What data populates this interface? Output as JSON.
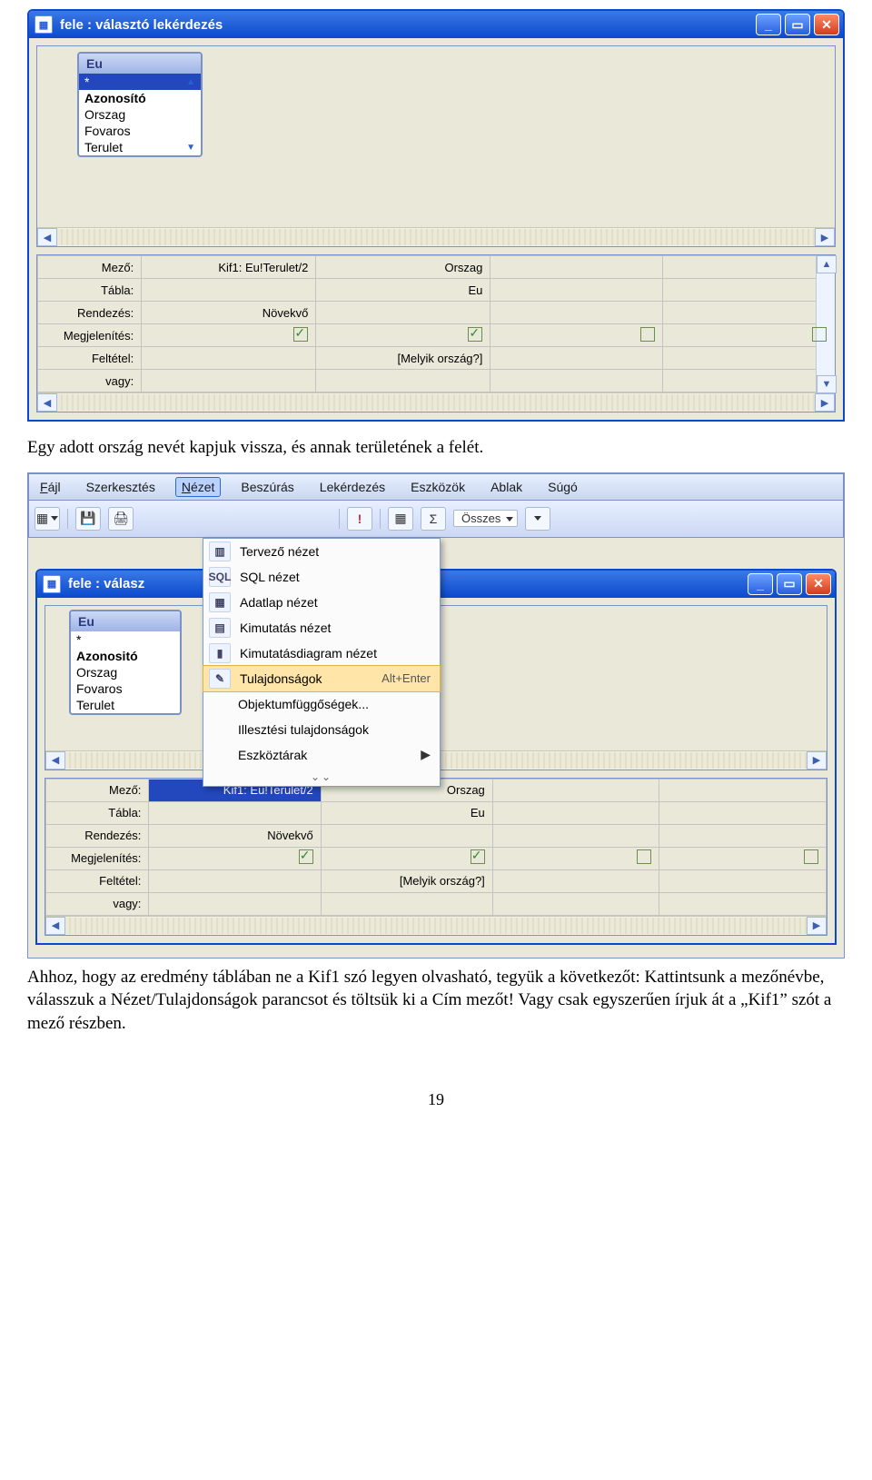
{
  "shot1": {
    "title": "fele : választó lekérdezés",
    "eu_panel_title": "Eu",
    "eu_fields": {
      "star": "*",
      "f1": "Azonosító",
      "f2": "Orszag",
      "f3": "Fovaros",
      "f4": "Terulet"
    },
    "grid_labels": {
      "mezo": "Mező:",
      "tabla": "Tábla:",
      "rendezes": "Rendezés:",
      "megj": "Megjelenítés:",
      "feltetel": "Feltétel:",
      "vagy": "vagy:"
    },
    "grid": {
      "c1": {
        "mezo": "Kif1: Eu!Terulet/2",
        "rendezes": "Növekvő"
      },
      "c2": {
        "mezo": "Orszag",
        "tabla": "Eu",
        "feltetel": "[Melyik ország?]"
      }
    }
  },
  "para1": "Egy adott ország nevét kapjuk vissza, és annak területének a felét.",
  "shot2": {
    "menubar": {
      "fajl": "Fájl",
      "szerk": "Szerkesztés",
      "nezet": "Nézet",
      "beszur": "Beszúrás",
      "lekerd": "Lekérdezés",
      "eszk": "Eszközök",
      "ablak": "Ablak",
      "sugo": "Súgó"
    },
    "toolbar": {
      "osszes": "Összes",
      "sigma": "Σ",
      "bang": "!"
    },
    "nezet_menu": {
      "tervezo": "Tervező nézet",
      "sql": "SQL nézet",
      "sql_icon": "SQL",
      "adatlap": "Adatlap nézet",
      "kimutatas": "Kimutatás nézet",
      "kimdiag": "Kimutatásdiagram nézet",
      "tulajd": "Tulajdonságok",
      "tulajd_shortcut": "Alt+Enter",
      "objfugg": "Objektumfüggőségek...",
      "illeszt": "Illesztési tulajdonságok",
      "eszkozt": "Eszköztárak"
    },
    "subwindow_title": "fele : válasz",
    "eu_panel_title": "Eu",
    "eu_fields": {
      "star": "*",
      "f1": "Azonositó",
      "f2": "Orszag",
      "f3": "Fovaros",
      "f4": "Terulet"
    },
    "grid_labels": {
      "mezo": "Mező:",
      "tabla": "Tábla:",
      "rendezes": "Rendezés:",
      "megj": "Megjelenítés:",
      "feltetel": "Feltétel:",
      "vagy": "vagy:"
    },
    "grid": {
      "c1": {
        "mezo": "Kif1: Eu!Terulet/2",
        "rendezes": "Növekvő"
      },
      "c2": {
        "mezo": "Orszag",
        "tabla": "Eu",
        "feltetel": "[Melyik ország?]"
      }
    }
  },
  "para2": "Ahhoz, hogy az eredmény táblában ne a Kif1 szó legyen olvasható, tegyük a következőt: Kattintsunk a mezőnévbe, válasszuk a Nézet/Tulajdonságok parancsot és töltsük ki a Cím mezőt! Vagy csak egyszerűen írjuk át a „Kif1” szót a mező részben.",
  "page_number": "19"
}
